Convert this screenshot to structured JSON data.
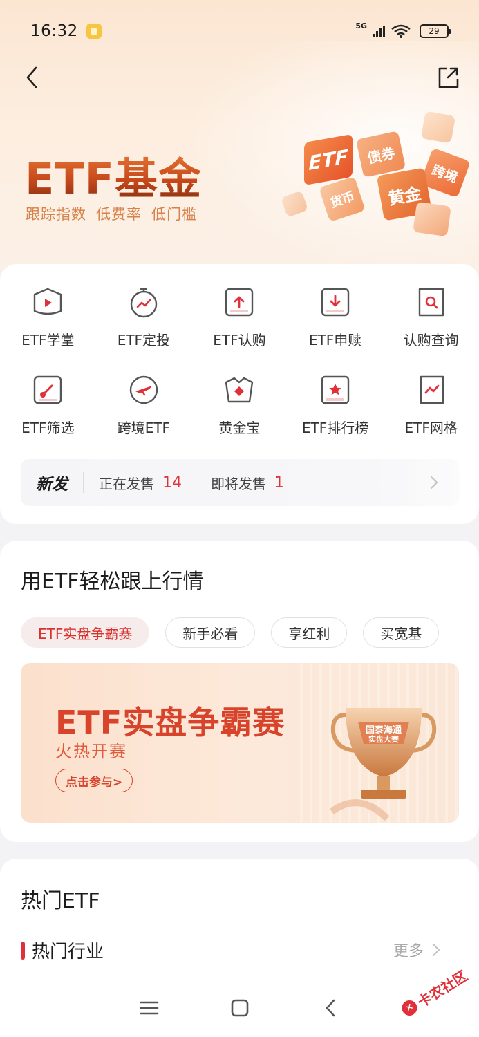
{
  "status_bar": {
    "time": "16:32",
    "network": "5G",
    "battery": "29"
  },
  "hero": {
    "title": "ETF基金",
    "subtitles": [
      "跟踪指数",
      "低费率",
      "低门槛"
    ],
    "cube_labels": [
      "ETF",
      "债券",
      "跨境",
      "货币",
      "黄金"
    ]
  },
  "grid": {
    "items": [
      {
        "label": "ETF学堂",
        "icon": "school-icon"
      },
      {
        "label": "ETF定投",
        "icon": "timer-chart-icon"
      },
      {
        "label": "ETF认购",
        "icon": "subscribe-icon"
      },
      {
        "label": "ETF申赎",
        "icon": "redeem-icon"
      },
      {
        "label": "认购查询",
        "icon": "query-icon"
      },
      {
        "label": "ETF筛选",
        "icon": "filter-icon"
      },
      {
        "label": "跨境ETF",
        "icon": "plane-icon"
      },
      {
        "label": "黄金宝",
        "icon": "gold-icon"
      },
      {
        "label": "ETF排行榜",
        "icon": "ranking-icon"
      },
      {
        "label": "ETF网格",
        "icon": "grid-chart-icon"
      }
    ]
  },
  "new_issue": {
    "tag": "新发",
    "on_sale_label": "正在发售",
    "on_sale_count": "14",
    "upcoming_label": "即将发售",
    "upcoming_count": "1"
  },
  "market_section": {
    "title": "用ETF轻松跟上行情",
    "chips": [
      "ETF实盘争霸赛",
      "新手必看",
      "享红利",
      "买宽基"
    ],
    "active_chip": 0,
    "banner": {
      "title": "ETF实盘争霸赛",
      "subtitle": "火热开赛",
      "button": "点击参与>",
      "trophy_text": "国泰海通 实盘大赛"
    }
  },
  "hot_section": {
    "title": "热门ETF",
    "subsection": "热门行业",
    "more": "更多"
  },
  "watermark": {
    "text": "卡农社区"
  },
  "colors": {
    "accent_red": "#e0303a",
    "hero_orange": "#d6824a",
    "banner_red": "#d8432b"
  }
}
